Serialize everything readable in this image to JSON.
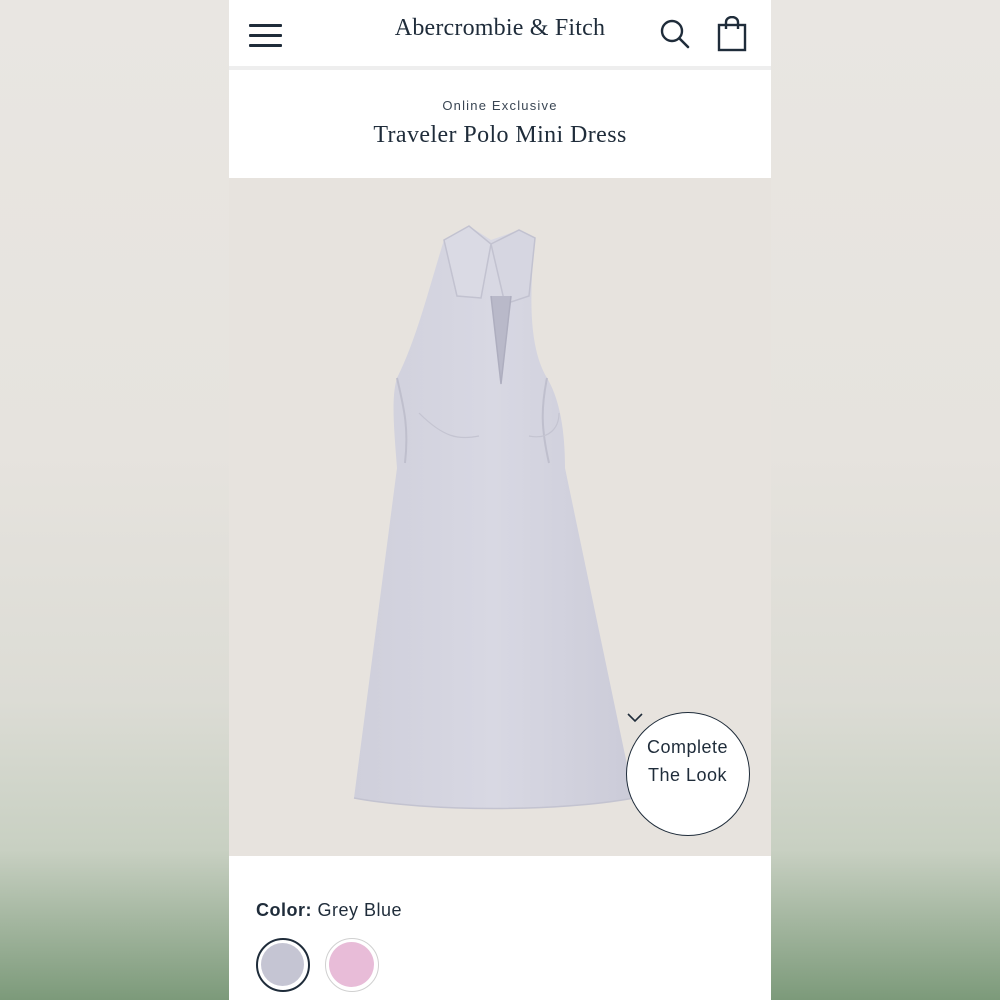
{
  "header": {
    "brand": "Abercrombie & Fitch",
    "icons": [
      "menu-icon",
      "search-icon",
      "shopping-bag-icon"
    ]
  },
  "product": {
    "eyebrow": "Online Exclusive",
    "title": "Traveler Polo Mini Dress",
    "image_alt": "Grey blue sleeveless polo collar mini dress"
  },
  "complete_look": {
    "line1": "Complete",
    "line2": "The Look",
    "icon": "chevron-down-icon"
  },
  "color": {
    "label": "Color:",
    "selected": "Grey Blue",
    "swatches": [
      {
        "name": "Grey Blue",
        "hex": "#c5c5d3",
        "selected": true
      },
      {
        "name": "Pink",
        "hex": "#e8bcd8",
        "selected": false
      }
    ]
  },
  "colors": {
    "text": "#1f2c3a",
    "image_bg": "#e7e3de",
    "dress": "#d3d3de"
  }
}
